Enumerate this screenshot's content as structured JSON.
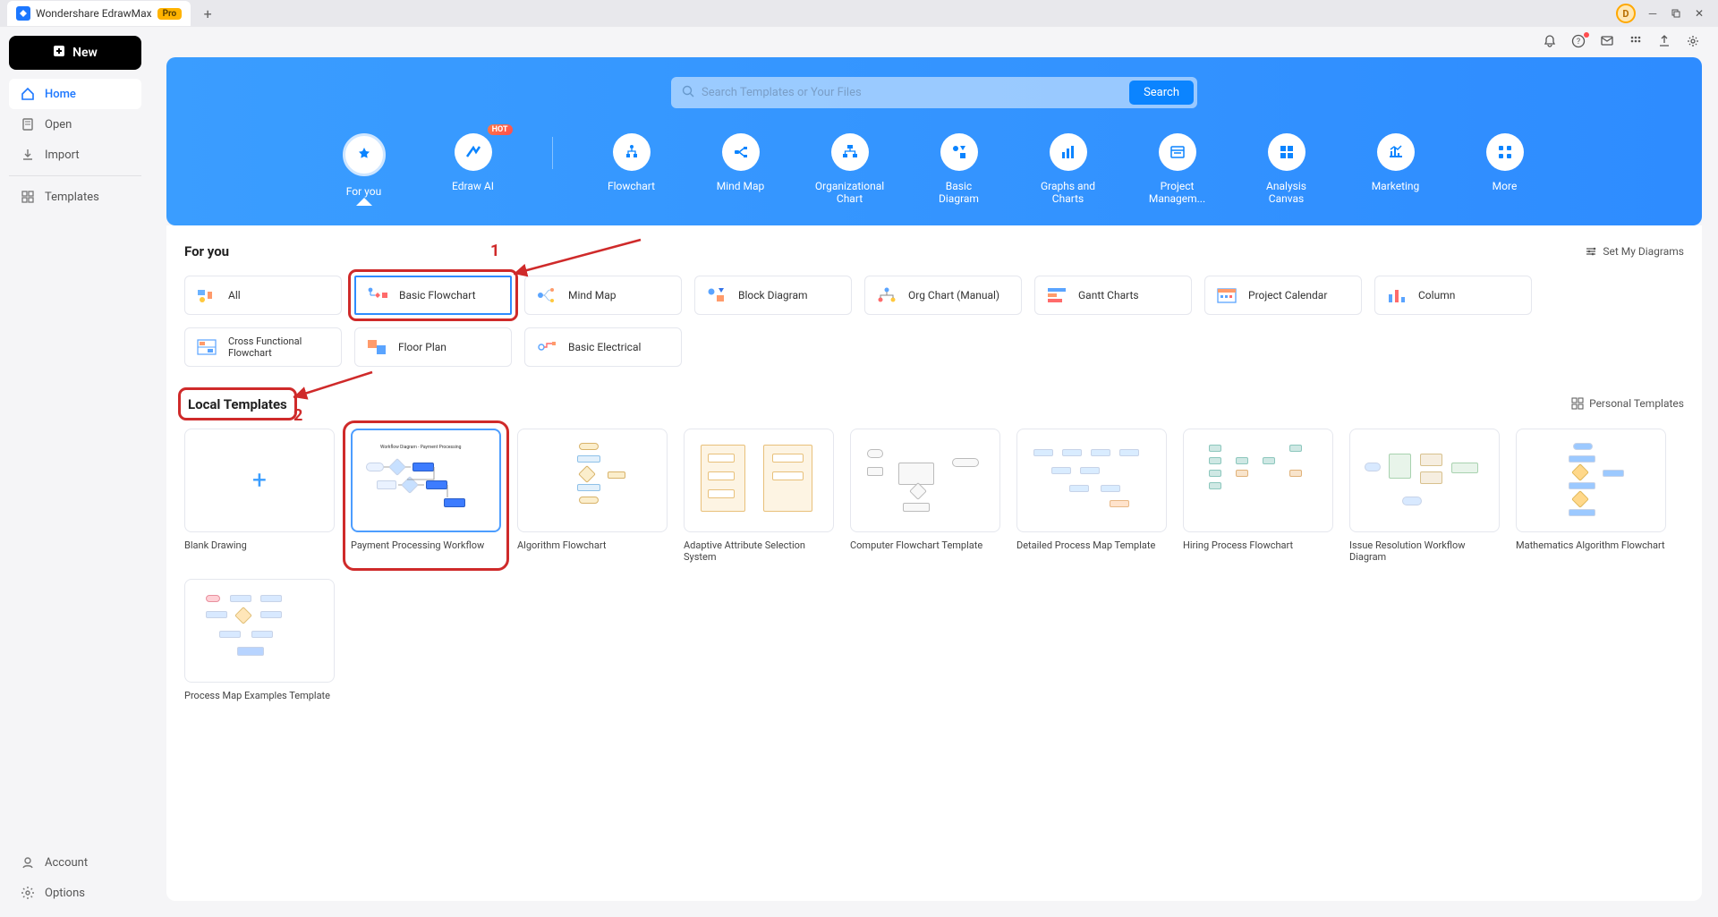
{
  "titlebar": {
    "app_name": "Wondershare EdrawMax",
    "pro_label": "Pro",
    "avatar_letter": "D"
  },
  "sidebar": {
    "new_label": "New",
    "items": [
      {
        "label": "Home"
      },
      {
        "label": "Open"
      },
      {
        "label": "Import"
      },
      {
        "label": "Templates"
      },
      {
        "label": "Account"
      },
      {
        "label": "Options"
      }
    ]
  },
  "hero": {
    "search_placeholder": "Search Templates or Your Files",
    "search_button": "Search",
    "categories": [
      {
        "label": "For you"
      },
      {
        "label": "Edraw AI"
      },
      {
        "label": "Flowchart"
      },
      {
        "label": "Mind Map"
      },
      {
        "label": "Organizational Chart"
      },
      {
        "label": "Basic Diagram"
      },
      {
        "label": "Graphs and Charts"
      },
      {
        "label": "Project Managem..."
      },
      {
        "label": "Analysis Canvas"
      },
      {
        "label": "Marketing"
      },
      {
        "label": "More"
      }
    ],
    "hot_badge": "HOT"
  },
  "for_you": {
    "title": "For you",
    "set_link": "Set My Diagrams",
    "chips": [
      {
        "label": "All"
      },
      {
        "label": "Basic Flowchart"
      },
      {
        "label": "Mind Map"
      },
      {
        "label": "Block Diagram"
      },
      {
        "label": "Org Chart (Manual)"
      },
      {
        "label": "Gantt Charts"
      },
      {
        "label": "Project Calendar"
      },
      {
        "label": "Column"
      },
      {
        "label": "Cross Functional Flowchart"
      },
      {
        "label": "Floor Plan"
      },
      {
        "label": "Basic Electrical"
      }
    ]
  },
  "local_templates": {
    "title": "Local Templates",
    "personal_link": "Personal Templates",
    "items": [
      {
        "label": "Blank Drawing"
      },
      {
        "label": "Payment Processing Workflow"
      },
      {
        "label": "Algorithm Flowchart"
      },
      {
        "label": "Adaptive Attribute Selection System"
      },
      {
        "label": "Computer Flowchart Template"
      },
      {
        "label": "Detailed Process Map Template"
      },
      {
        "label": "Hiring Process Flowchart"
      },
      {
        "label": "Issue Resolution Workflow Diagram"
      },
      {
        "label": "Mathematics Algorithm Flowchart"
      },
      {
        "label": "Process Map Examples Template"
      }
    ]
  },
  "annotations": {
    "num1": "1",
    "num2": "2"
  }
}
